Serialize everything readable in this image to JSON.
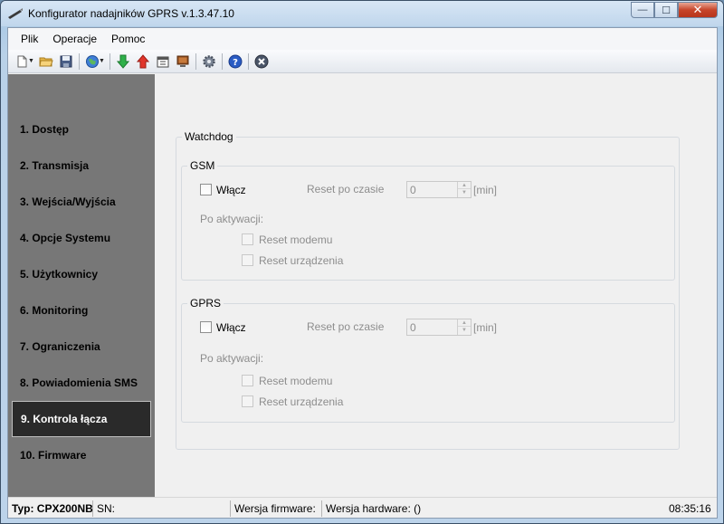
{
  "window": {
    "title": "Konfigurator nadajników GPRS v.1.3.47.10",
    "controls": {
      "minimize": "—",
      "maximize": "☐",
      "close": "✕"
    }
  },
  "menu": {
    "items": [
      "Plik",
      "Operacje",
      "Pomoc"
    ]
  },
  "toolbar": {
    "buttons": [
      "new-file-icon",
      "open-folder-icon",
      "save-icon",
      "globe-icon",
      "download-arrow-icon",
      "upload-arrow-icon",
      "calendar-icon",
      "monitor-icon",
      "settings-gear-icon",
      "help-icon",
      "disconnect-icon"
    ]
  },
  "sidebar": {
    "items": [
      {
        "label": "1. Dostęp"
      },
      {
        "label": "2. Transmisja"
      },
      {
        "label": "3. Wejścia/Wyjścia"
      },
      {
        "label": "4. Opcje Systemu"
      },
      {
        "label": "5. Użytkownicy"
      },
      {
        "label": "6. Monitoring"
      },
      {
        "label": "7. Ograniczenia"
      },
      {
        "label": "8. Powiadomienia SMS"
      },
      {
        "label": "9. Kontrola łącza",
        "active": true
      },
      {
        "label": "10. Firmware"
      }
    ]
  },
  "watchdog": {
    "title": "Watchdog",
    "gsm": {
      "title": "GSM",
      "enable_label": "Włącz",
      "reset_after_label": "Reset po czasie",
      "reset_value": "0",
      "unit": "[min]",
      "on_activation_label": "Po aktywacji:",
      "reset_modem_label": "Reset modemu",
      "reset_device_label": "Reset urządzenia"
    },
    "gprs": {
      "title": "GPRS",
      "enable_label": "Włącz",
      "reset_after_label": "Reset po czasie",
      "reset_value": "0",
      "unit": "[min]",
      "on_activation_label": "Po aktywacji:",
      "reset_modem_label": "Reset modemu",
      "reset_device_label": "Reset urządzenia"
    }
  },
  "statusbar": {
    "type": "Typ: CPX200NB",
    "sn": "SN:",
    "firmware": "Wersja firmware:",
    "hardware": "Wersja hardware: ()",
    "time": "08:35:16"
  }
}
